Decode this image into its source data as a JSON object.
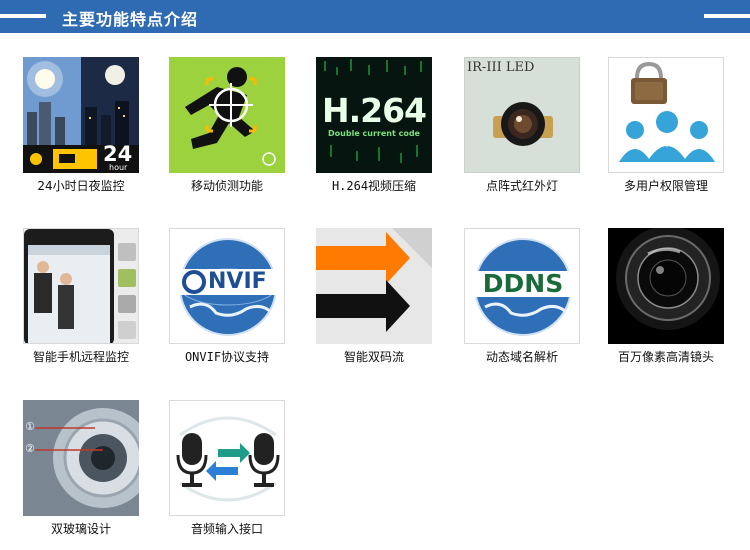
{
  "header": {
    "title": "主要功能特点介绍"
  },
  "features": [
    {
      "caption": "24小时日夜监控",
      "badge_number": "24",
      "badge_sub": "hour"
    },
    {
      "caption": "移动侦测功能"
    },
    {
      "caption": "H.264视频压缩",
      "codec_text": "H.264",
      "codec_sub": "Double current code"
    },
    {
      "caption": "点阵式红外灯",
      "led_label": "IR-III LED"
    },
    {
      "caption": "多用户权限管理"
    },
    {
      "caption": "智能手机远程监控"
    },
    {
      "caption": "ONVIF协议支持",
      "logo_text": "NVIF"
    },
    {
      "caption": "智能双码流"
    },
    {
      "caption": "动态域名解析",
      "logo_text": "DDNS"
    },
    {
      "caption": "百万像素高清镜头"
    },
    {
      "caption": "双玻璃设计",
      "marker_1": "①",
      "marker_2": "②"
    },
    {
      "caption": "音频输入接口"
    }
  ]
}
